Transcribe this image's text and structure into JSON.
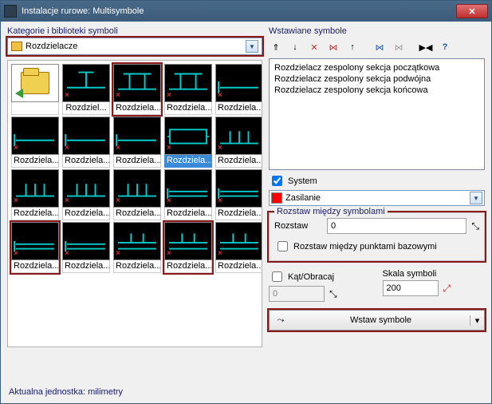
{
  "window": {
    "title": "Instalacje rurowe: Multisymbole"
  },
  "left": {
    "categories_label": "Kategorie i biblioteki symboli",
    "category_value": "Rozdzielacze",
    "cells": [
      {
        "cap": "",
        "type": "folder"
      },
      {
        "cap": "Rozdziel...",
        "type": "a"
      },
      {
        "cap": "Rozdziela...",
        "type": "b",
        "hl": true
      },
      {
        "cap": "Rozdziela...",
        "type": "b"
      },
      {
        "cap": "Rozdziela...",
        "type": "c"
      },
      {
        "cap": "Rozdziela...",
        "type": "c"
      },
      {
        "cap": "Rozdziela...",
        "type": "c"
      },
      {
        "cap": "Rozdziela...",
        "type": "c"
      },
      {
        "cap": "Rozdziela...",
        "type": "d",
        "sel": true
      },
      {
        "cap": "Rozdziela...",
        "type": "e"
      },
      {
        "cap": "Rozdziela...",
        "type": "e"
      },
      {
        "cap": "Rozdziela...",
        "type": "e"
      },
      {
        "cap": "Rozdziela...",
        "type": "e"
      },
      {
        "cap": "Rozdziela...",
        "type": "f"
      },
      {
        "cap": "Rozdziela...",
        "type": "f"
      },
      {
        "cap": "Rozdziela...",
        "type": "f",
        "hl": true
      },
      {
        "cap": "Rozdziela...",
        "type": "f"
      },
      {
        "cap": "Rozdziela...",
        "type": "g"
      },
      {
        "cap": "Rozdziela...",
        "type": "g",
        "hl": true
      },
      {
        "cap": "Rozdziela...",
        "type": "g"
      }
    ]
  },
  "right": {
    "inserted_label": "Wstawiane symbole",
    "list": [
      "Rozdzielacz zespolony sekcja początkowa",
      "Rozdzielacz zespolony sekcja podwójna",
      "Rozdzielacz zespolony sekcja końcowa"
    ],
    "system_label": "System",
    "system_value": "Zasilanie",
    "spacing_group": "Rozstaw między symbolami",
    "spacing_label": "Rozstaw",
    "spacing_value": "0",
    "spacing_base": "Rozstaw między punktami bazowymi",
    "angle_label": "Kąt/Obracaj",
    "angle_value": "0",
    "scale_label": "Skala symboli",
    "scale_value": "200",
    "insert_label": "Wstaw symbole"
  },
  "footer": {
    "units": "Aktualna jednostka: milimetry"
  }
}
